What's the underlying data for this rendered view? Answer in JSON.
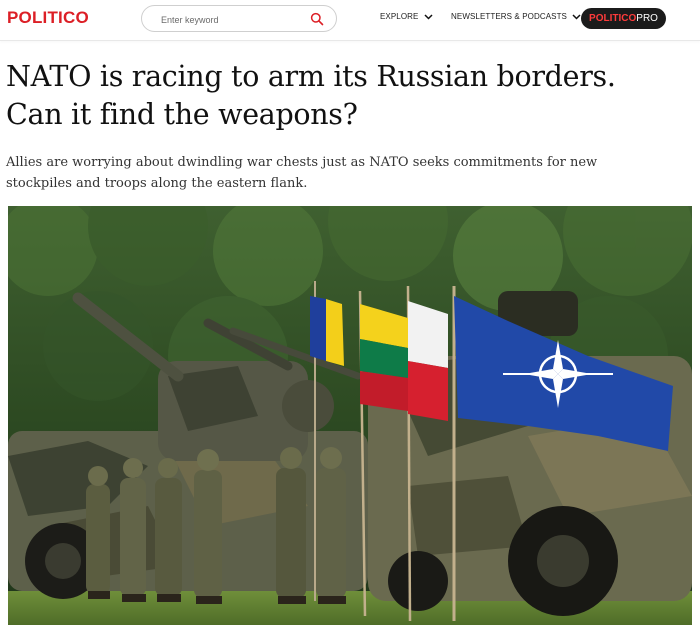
{
  "header": {
    "logo": "POLITICO",
    "search": {
      "placeholder": "Enter keyword"
    },
    "nav": [
      {
        "label": "EXPLORE"
      },
      {
        "label": "NEWSLETTERS & PODCASTS"
      }
    ],
    "pro_button": {
      "part1": "POLITICO",
      "part2": "PRO"
    }
  },
  "article": {
    "headline": "NATO is racing to arm its Russian borders. Can it find the weapons?",
    "dek": "Allies are worrying about dwindling war chests just as NATO seeks commitments for new stockpiles and troops along the eastern flank.",
    "photo": {
      "subject": "soldiers-with-armored-vehicles-and-flags",
      "flags": [
        "Romania",
        "Lithuania",
        "Poland",
        "NATO"
      ]
    }
  },
  "colors": {
    "brand_red": "#dc1f26",
    "pro_button_bg": "#1b1b1b",
    "nato_blue": "#1f47a0"
  }
}
